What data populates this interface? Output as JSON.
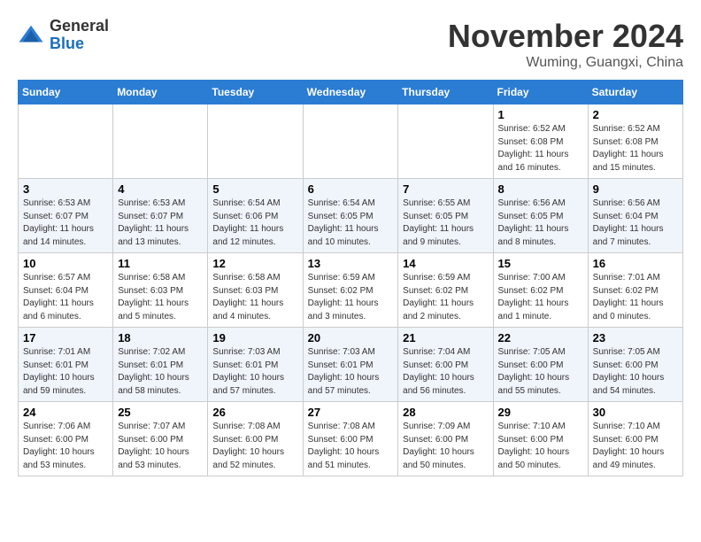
{
  "logo": {
    "general": "General",
    "blue": "Blue"
  },
  "title": "November 2024",
  "location": "Wuming, Guangxi, China",
  "weekdays": [
    "Sunday",
    "Monday",
    "Tuesday",
    "Wednesday",
    "Thursday",
    "Friday",
    "Saturday"
  ],
  "weeks": [
    [
      {
        "day": "",
        "info": ""
      },
      {
        "day": "",
        "info": ""
      },
      {
        "day": "",
        "info": ""
      },
      {
        "day": "",
        "info": ""
      },
      {
        "day": "",
        "info": ""
      },
      {
        "day": "1",
        "info": "Sunrise: 6:52 AM\nSunset: 6:08 PM\nDaylight: 11 hours and 16 minutes."
      },
      {
        "day": "2",
        "info": "Sunrise: 6:52 AM\nSunset: 6:08 PM\nDaylight: 11 hours and 15 minutes."
      }
    ],
    [
      {
        "day": "3",
        "info": "Sunrise: 6:53 AM\nSunset: 6:07 PM\nDaylight: 11 hours and 14 minutes."
      },
      {
        "day": "4",
        "info": "Sunrise: 6:53 AM\nSunset: 6:07 PM\nDaylight: 11 hours and 13 minutes."
      },
      {
        "day": "5",
        "info": "Sunrise: 6:54 AM\nSunset: 6:06 PM\nDaylight: 11 hours and 12 minutes."
      },
      {
        "day": "6",
        "info": "Sunrise: 6:54 AM\nSunset: 6:05 PM\nDaylight: 11 hours and 10 minutes."
      },
      {
        "day": "7",
        "info": "Sunrise: 6:55 AM\nSunset: 6:05 PM\nDaylight: 11 hours and 9 minutes."
      },
      {
        "day": "8",
        "info": "Sunrise: 6:56 AM\nSunset: 6:05 PM\nDaylight: 11 hours and 8 minutes."
      },
      {
        "day": "9",
        "info": "Sunrise: 6:56 AM\nSunset: 6:04 PM\nDaylight: 11 hours and 7 minutes."
      }
    ],
    [
      {
        "day": "10",
        "info": "Sunrise: 6:57 AM\nSunset: 6:04 PM\nDaylight: 11 hours and 6 minutes."
      },
      {
        "day": "11",
        "info": "Sunrise: 6:58 AM\nSunset: 6:03 PM\nDaylight: 11 hours and 5 minutes."
      },
      {
        "day": "12",
        "info": "Sunrise: 6:58 AM\nSunset: 6:03 PM\nDaylight: 11 hours and 4 minutes."
      },
      {
        "day": "13",
        "info": "Sunrise: 6:59 AM\nSunset: 6:02 PM\nDaylight: 11 hours and 3 minutes."
      },
      {
        "day": "14",
        "info": "Sunrise: 6:59 AM\nSunset: 6:02 PM\nDaylight: 11 hours and 2 minutes."
      },
      {
        "day": "15",
        "info": "Sunrise: 7:00 AM\nSunset: 6:02 PM\nDaylight: 11 hours and 1 minute."
      },
      {
        "day": "16",
        "info": "Sunrise: 7:01 AM\nSunset: 6:02 PM\nDaylight: 11 hours and 0 minutes."
      }
    ],
    [
      {
        "day": "17",
        "info": "Sunrise: 7:01 AM\nSunset: 6:01 PM\nDaylight: 10 hours and 59 minutes."
      },
      {
        "day": "18",
        "info": "Sunrise: 7:02 AM\nSunset: 6:01 PM\nDaylight: 10 hours and 58 minutes."
      },
      {
        "day": "19",
        "info": "Sunrise: 7:03 AM\nSunset: 6:01 PM\nDaylight: 10 hours and 57 minutes."
      },
      {
        "day": "20",
        "info": "Sunrise: 7:03 AM\nSunset: 6:01 PM\nDaylight: 10 hours and 57 minutes."
      },
      {
        "day": "21",
        "info": "Sunrise: 7:04 AM\nSunset: 6:00 PM\nDaylight: 10 hours and 56 minutes."
      },
      {
        "day": "22",
        "info": "Sunrise: 7:05 AM\nSunset: 6:00 PM\nDaylight: 10 hours and 55 minutes."
      },
      {
        "day": "23",
        "info": "Sunrise: 7:05 AM\nSunset: 6:00 PM\nDaylight: 10 hours and 54 minutes."
      }
    ],
    [
      {
        "day": "24",
        "info": "Sunrise: 7:06 AM\nSunset: 6:00 PM\nDaylight: 10 hours and 53 minutes."
      },
      {
        "day": "25",
        "info": "Sunrise: 7:07 AM\nSunset: 6:00 PM\nDaylight: 10 hours and 53 minutes."
      },
      {
        "day": "26",
        "info": "Sunrise: 7:08 AM\nSunset: 6:00 PM\nDaylight: 10 hours and 52 minutes."
      },
      {
        "day": "27",
        "info": "Sunrise: 7:08 AM\nSunset: 6:00 PM\nDaylight: 10 hours and 51 minutes."
      },
      {
        "day": "28",
        "info": "Sunrise: 7:09 AM\nSunset: 6:00 PM\nDaylight: 10 hours and 50 minutes."
      },
      {
        "day": "29",
        "info": "Sunrise: 7:10 AM\nSunset: 6:00 PM\nDaylight: 10 hours and 50 minutes."
      },
      {
        "day": "30",
        "info": "Sunrise: 7:10 AM\nSunset: 6:00 PM\nDaylight: 10 hours and 49 minutes."
      }
    ]
  ]
}
